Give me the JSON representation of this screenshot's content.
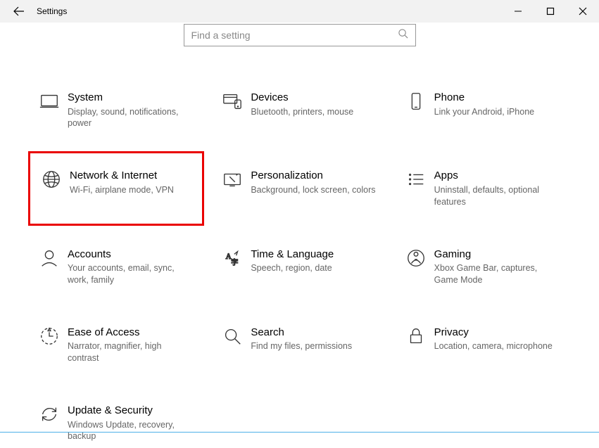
{
  "window": {
    "title": "Settings"
  },
  "search": {
    "placeholder": "Find a setting"
  },
  "tiles": {
    "system": {
      "title": "System",
      "desc": "Display, sound, notifications, power"
    },
    "devices": {
      "title": "Devices",
      "desc": "Bluetooth, printers, mouse"
    },
    "phone": {
      "title": "Phone",
      "desc": "Link your Android, iPhone"
    },
    "network": {
      "title": "Network & Internet",
      "desc": "Wi-Fi, airplane mode, VPN"
    },
    "personal": {
      "title": "Personalization",
      "desc": "Background, lock screen, colors"
    },
    "apps": {
      "title": "Apps",
      "desc": "Uninstall, defaults, optional features"
    },
    "accounts": {
      "title": "Accounts",
      "desc": "Your accounts, email, sync, work, family"
    },
    "time": {
      "title": "Time & Language",
      "desc": "Speech, region, date"
    },
    "gaming": {
      "title": "Gaming",
      "desc": "Xbox Game Bar, captures, Game Mode"
    },
    "ease": {
      "title": "Ease of Access",
      "desc": "Narrator, magnifier, high contrast"
    },
    "searchTile": {
      "title": "Search",
      "desc": "Find my files, permissions"
    },
    "privacy": {
      "title": "Privacy",
      "desc": "Location, camera, microphone"
    },
    "update": {
      "title": "Update & Security",
      "desc": "Windows Update, recovery, backup"
    }
  }
}
